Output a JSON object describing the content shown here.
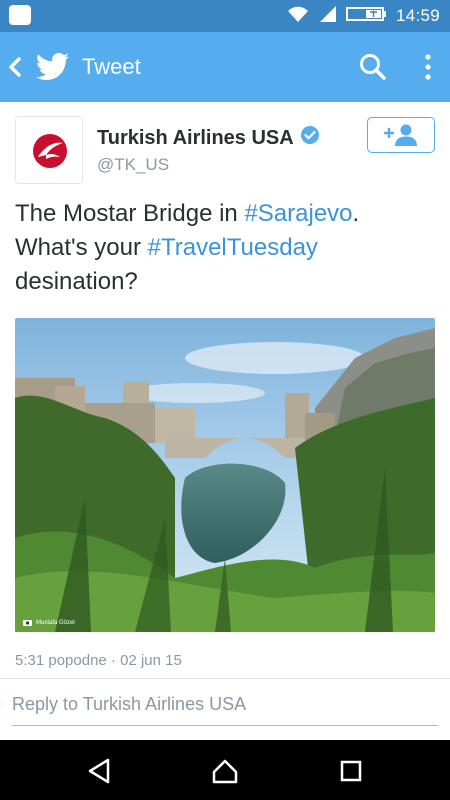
{
  "status_bar": {
    "time": "14:59",
    "icons": [
      "app-notification-icon",
      "wifi-icon",
      "signal-icon",
      "battery-icon"
    ]
  },
  "app_bar": {
    "title": "Tweet",
    "icons": [
      "back-icon",
      "twitter-bird-icon",
      "search-icon",
      "overflow-menu-icon"
    ]
  },
  "tweet": {
    "author_name": "Turkish Airlines USA",
    "handle": "@TK_US",
    "verified": true,
    "text_parts": {
      "p1": "The Mostar Bridge in ",
      "hashtag1": "#Sarajevo",
      "p2": ".",
      "p3": "What's your ",
      "hashtag2": "#TravelTuesday",
      "p4": "desination?"
    },
    "photo_credit": "Mustafa Gözel",
    "timestamp": "5:31 popodne · 02 jun 15"
  },
  "reply": {
    "placeholder": "Reply to Turkish Airlines USA"
  },
  "colors": {
    "status_bar": "#3a85c4",
    "app_bar": "#55acee",
    "hashtag": "#3b94d9",
    "brand_red": "#c8102e"
  }
}
